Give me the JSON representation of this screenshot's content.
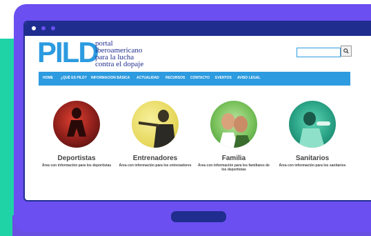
{
  "site": {
    "logo": "PILD",
    "tagline": [
      "portal",
      "iberoamericano",
      "para la lucha",
      "contra el dopaje"
    ]
  },
  "search": {
    "placeholder": "",
    "button_icon": "search-icon"
  },
  "nav": [
    "HOME",
    "¿QUÉ ES PILD?",
    "INFORMACION BÁSICA",
    "ACTUALIDAD",
    "RECURSOS",
    "CONTACTO",
    "EVENTOS",
    "AVISO LEGAL"
  ],
  "categories": [
    {
      "title": "Deportistas",
      "desc": "Área con información para los deportistas"
    },
    {
      "title": "Entrenadores",
      "desc": "Área con información para los entrenadores"
    },
    {
      "title": "Familia",
      "desc": "Área con información para los familiares de los deportistas"
    },
    {
      "title": "Sanitarios",
      "desc": "Área con información para los sanitarios"
    }
  ],
  "colors": {
    "accent": "#2c9be0",
    "laptop": "#6b4ff0",
    "teal": "#1fd3a7",
    "navy": "#1f2d8f"
  }
}
